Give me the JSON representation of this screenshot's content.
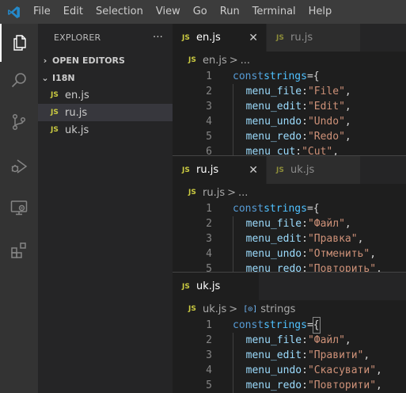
{
  "menu": [
    "File",
    "Edit",
    "Selection",
    "View",
    "Go",
    "Run",
    "Terminal",
    "Help"
  ],
  "activity_icons": [
    "explorer-icon",
    "search-icon",
    "source-control-icon",
    "run-debug-icon",
    "remote-explorer-icon",
    "extensions-icon"
  ],
  "sidebar": {
    "title": "EXPLORER",
    "more": "···",
    "sections": {
      "open_editors": "OPEN EDITORS",
      "folder": "I18N"
    },
    "files": [
      {
        "badge": "JS",
        "name": "en.js"
      },
      {
        "badge": "JS",
        "name": "ru.js"
      },
      {
        "badge": "JS",
        "name": "uk.js"
      }
    ]
  },
  "groups": [
    {
      "tabs": [
        {
          "badge": "JS",
          "name": "en.js",
          "close": "✕"
        },
        {
          "badge": "JS",
          "name": "ru.js"
        }
      ],
      "breadcrumb": {
        "badge": "JS",
        "file": "en.js",
        "sep": ">",
        "tail": "..."
      },
      "lines": [
        {
          "n": "1",
          "key": "",
          "val": ""
        },
        {
          "n": "2",
          "key": "menu_file",
          "val": "\"File\""
        },
        {
          "n": "3",
          "key": "menu_edit",
          "val": "\"Edit\""
        },
        {
          "n": "4",
          "key": "menu_undo",
          "val": "\"Undo\""
        },
        {
          "n": "5",
          "key": "menu_redo",
          "val": "\"Redo\""
        },
        {
          "n": "6",
          "key": "menu_cut",
          "val": "\"Cut\""
        }
      ]
    },
    {
      "tabs": [
        {
          "badge": "JS",
          "name": "ru.js",
          "close": "✕"
        },
        {
          "badge": "JS",
          "name": "uk.js"
        }
      ],
      "breadcrumb": {
        "badge": "JS",
        "file": "ru.js",
        "sep": ">",
        "tail": "..."
      },
      "lines": [
        {
          "n": "1",
          "key": "",
          "val": ""
        },
        {
          "n": "2",
          "key": "menu_file",
          "val": "\"Файл\""
        },
        {
          "n": "3",
          "key": "menu_edit",
          "val": "\"Правка\""
        },
        {
          "n": "4",
          "key": "menu_undo",
          "val": "\"Отменить\""
        },
        {
          "n": "5",
          "key": "menu_redo",
          "val": "\"Повторить\""
        }
      ]
    },
    {
      "tabs": [
        {
          "badge": "JS",
          "name": "uk.js"
        }
      ],
      "breadcrumb": {
        "badge": "JS",
        "file": "uk.js",
        "sep": ">",
        "symbol_icon": "[⊙]",
        "symbol": "strings"
      },
      "lines": [
        {
          "n": "1",
          "key": "",
          "val": ""
        },
        {
          "n": "2",
          "key": "menu_file",
          "val": "\"Файл\""
        },
        {
          "n": "3",
          "key": "menu_edit",
          "val": "\"Правити\""
        },
        {
          "n": "4",
          "key": "menu_undo",
          "val": "\"Скасувати\""
        },
        {
          "n": "5",
          "key": "menu_redo",
          "val": "\"Повторити\""
        }
      ]
    }
  ],
  "code": {
    "kw": "const",
    "var": "strings",
    "eq": "=",
    "brace": "{",
    "colon": ":",
    "comma": ","
  }
}
